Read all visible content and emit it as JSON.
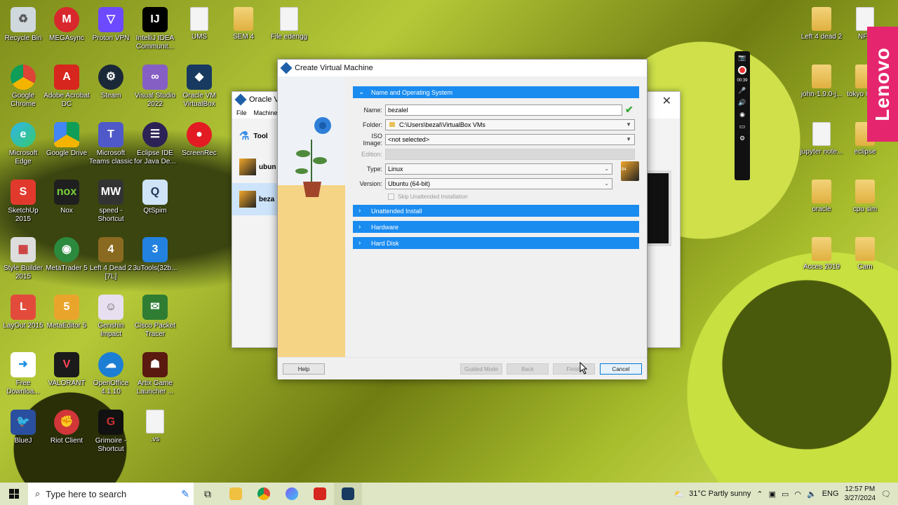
{
  "desktop_icons": [
    {
      "label": "Recycle Bin"
    },
    {
      "label": "MEGAsync"
    },
    {
      "label": "Proton VPN"
    },
    {
      "label": "IntelliJ IDEA Communit..."
    },
    {
      "label": "UMS"
    },
    {
      "label": "SEM 4"
    },
    {
      "label": "File edengg"
    },
    {
      "label": "Google Chrome"
    },
    {
      "label": "Adobe Acrobat DC"
    },
    {
      "label": "Steam"
    },
    {
      "label": "Visual Studio 2022"
    },
    {
      "label": "Oracle VM VirtualBox"
    },
    {
      "label": "Microsoft Edge"
    },
    {
      "label": "Google Drive"
    },
    {
      "label": "Microsoft Teams classic"
    },
    {
      "label": "Eclipse IDE for Java De..."
    },
    {
      "label": "ScreenRec"
    },
    {
      "label": "SketchUp 2015"
    },
    {
      "label": "Nox"
    },
    {
      "label": "speed - Shortcut"
    },
    {
      "label": "QtSpim"
    },
    {
      "label": "Style Builder 2015"
    },
    {
      "label": "MetaTrader 5"
    },
    {
      "label": "Left 4 Dead 2 [7L]"
    },
    {
      "label": "3uTools(32b..."
    },
    {
      "label": "LayOut 2015"
    },
    {
      "label": "MetaEditor 5"
    },
    {
      "label": "Genshin Impact"
    },
    {
      "label": "Cisco Packet Tracer"
    },
    {
      "label": "Free Downloa..."
    },
    {
      "label": "VALORANT"
    },
    {
      "label": "OpenOffice 4.1.10"
    },
    {
      "label": "Artix Game Launcher ..."
    },
    {
      "label": "BlueJ"
    },
    {
      "label": "Riot Client"
    },
    {
      "label": "Grimoire - Shortcut"
    },
    {
      "label": ".vs"
    },
    {
      "label": "Left 4 dead 2"
    },
    {
      "label": "NFS"
    },
    {
      "label": "john-1.9.0-j..."
    },
    {
      "label": "tokyo necro"
    },
    {
      "label": "jupyter note..."
    },
    {
      "label": "eclipse"
    },
    {
      "label": "oracle"
    },
    {
      "label": "cpu sim"
    },
    {
      "label": "Acces 2019"
    },
    {
      "label": "Cam"
    }
  ],
  "manager": {
    "title": "Oracle VM",
    "menu": [
      "File",
      "Machine"
    ],
    "tools_label": "Tool",
    "vm1": "ubun",
    "vm2": "beza"
  },
  "dialog": {
    "title": "Create Virtual Machine",
    "section_name_os": "Name and Operating System",
    "name_label": "Name:",
    "name_value": "bezalel",
    "folder_label": "Folder:",
    "folder_value": "C:\\Users\\bezal\\VirtualBox VMs",
    "iso_label": "ISO Image:",
    "iso_value": "<not selected>",
    "edition_label": "Edition:",
    "type_label": "Type:",
    "type_value": "Linux",
    "version_label": "Version:",
    "version_value": "Ubuntu (64-bit)",
    "os_badge_bits": "64",
    "skip_label": "Skip Unattended Installation",
    "section_unattended": "Unattended Install",
    "section_hardware": "Hardware",
    "section_disk": "Hard Disk",
    "help": "Help",
    "guided": "Guided Mode",
    "back": "Back",
    "finish": "Finish",
    "cancel": "Cancel"
  },
  "recorder": {
    "time": "00:39"
  },
  "lenovo": "Lenovo",
  "taskbar": {
    "search_placeholder": "Type here to search",
    "weather": "31°C  Partly sunny",
    "lang": "ENG",
    "time": "12:57 PM",
    "date": "3/27/2024"
  }
}
